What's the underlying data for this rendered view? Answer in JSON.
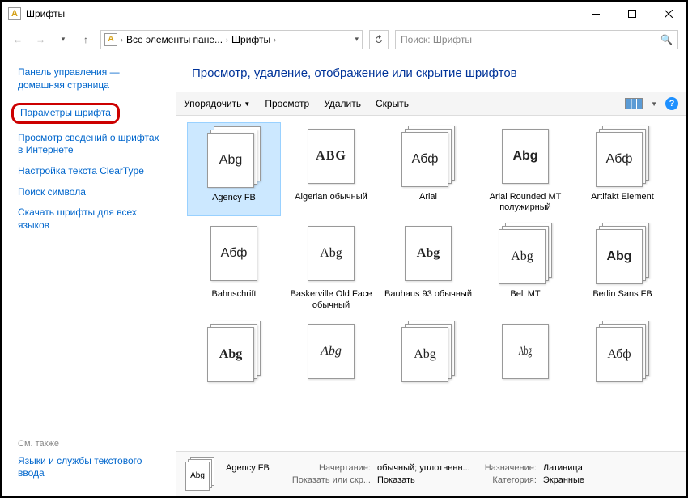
{
  "window": {
    "title": "Шрифты",
    "icon_letter": "A"
  },
  "nav": {
    "crumb1": "Все элементы пане...",
    "crumb2": "Шрифты",
    "search_placeholder": "Поиск: Шрифты"
  },
  "sidebar": {
    "home": "Панель управления — домашняя страница",
    "links": [
      "Параметры шрифта",
      "Просмотр сведений о шрифтах в Интернете",
      "Настройка текста ClearType",
      "Поиск символа",
      "Скачать шрифты для всех языков"
    ],
    "see_also_label": "См. также",
    "see_also_link": "Языки и службы текстового ввода"
  },
  "content": {
    "heading": "Просмотр, удаление, отображение или скрытие шрифтов",
    "toolbar": {
      "organize": "Упорядочить",
      "preview": "Просмотр",
      "delete": "Удалить",
      "hide": "Скрыть"
    },
    "fonts": [
      {
        "name": "Agency FB",
        "sample": "Abg",
        "stack": true,
        "selected": true,
        "style": "font-family:'Agency FB',sans-serif;font-stretch:condensed"
      },
      {
        "name": "Algerian обычный",
        "sample": "ABG",
        "stack": false,
        "style": "font-family:serif;font-weight:bold;letter-spacing:1px"
      },
      {
        "name": "Arial",
        "sample": "Абф",
        "stack": true,
        "style": "font-family:Arial"
      },
      {
        "name": "Arial Rounded MT полужирный",
        "sample": "Abg",
        "stack": false,
        "style": "font-family:Arial;font-weight:bold"
      },
      {
        "name": "Artifakt Element",
        "sample": "Абф",
        "stack": true,
        "style": "font-family:Arial"
      },
      {
        "name": "Bahnschrift",
        "sample": "Абф",
        "stack": false,
        "style": "font-family:Arial"
      },
      {
        "name": "Baskerville Old Face обычный",
        "sample": "Abg",
        "stack": false,
        "style": "font-family:Georgia,serif"
      },
      {
        "name": "Bauhaus 93 обычный",
        "sample": "Abg",
        "stack": false,
        "style": "font-family:Impact;font-weight:900"
      },
      {
        "name": "Bell MT",
        "sample": "Abg",
        "stack": true,
        "style": "font-family:Georgia,serif"
      },
      {
        "name": "Berlin Sans FB",
        "sample": "Abg",
        "stack": true,
        "style": "font-family:Arial;font-weight:bold"
      },
      {
        "name": "",
        "sample": "Abg",
        "stack": true,
        "style": "font-family:Arial Black;font-weight:900"
      },
      {
        "name": "",
        "sample": "Abg",
        "stack": false,
        "style": "font-family:cursive;font-style:italic"
      },
      {
        "name": "",
        "sample": "Abg",
        "stack": true,
        "style": "font-family:Georgia,serif"
      },
      {
        "name": "",
        "sample": "Abg",
        "stack": false,
        "style": "font-family:serif;font-stretch:ultra-condensed;transform:scaleX(0.6)"
      },
      {
        "name": "",
        "sample": "Абф",
        "stack": true,
        "style": "font-family:Georgia,serif"
      }
    ]
  },
  "details": {
    "name": "Agency FB",
    "sample": "Abg",
    "style_label": "Начертание:",
    "style_value": "обычный; уплотненн...",
    "show_label": "Показать или скр...",
    "show_value": "Показать",
    "designed_label": "Назначение:",
    "designed_value": "Латиница",
    "category_label": "Категория:",
    "category_value": "Экранные"
  }
}
